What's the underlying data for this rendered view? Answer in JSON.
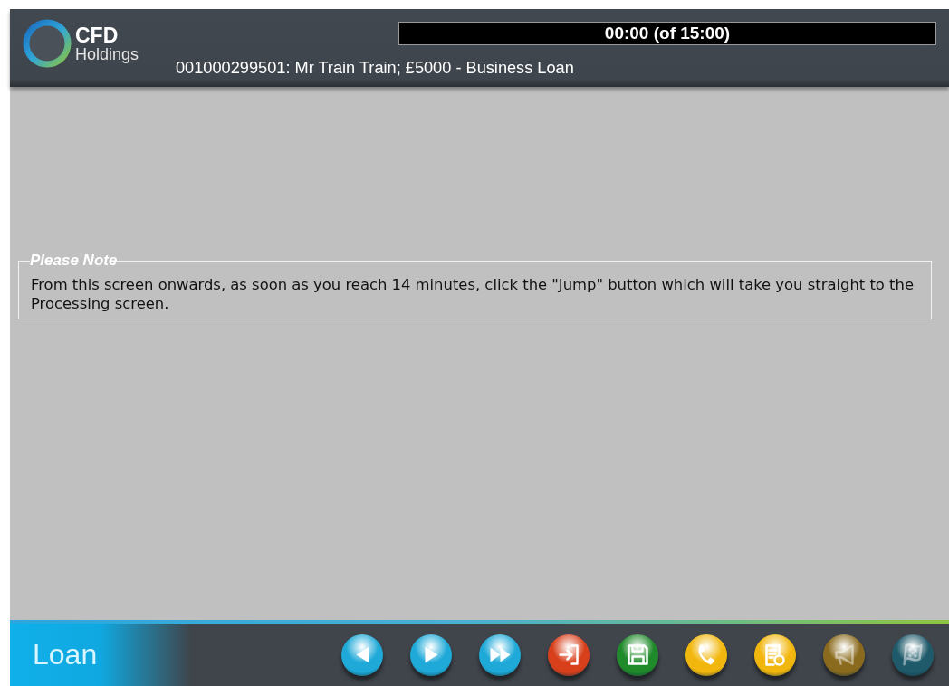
{
  "header": {
    "logo": {
      "name": "CFD",
      "subtitle": "Holdings"
    },
    "timer": "00:00 (of 15:00)",
    "case_line": "001000299501: Mr Train Train; £5000 - Business Loan"
  },
  "note": {
    "title": "Please Note",
    "text": "From this screen onwards, as soon as you reach 14 minutes, click the \"Jump\" button which will take you straight to the Processing screen."
  },
  "footer": {
    "section": "Loan",
    "buttons": [
      {
        "kind": "back",
        "color": "#1fa9d8",
        "disabled": false
      },
      {
        "kind": "forward",
        "color": "#1fa9d8",
        "disabled": false
      },
      {
        "kind": "jump",
        "color": "#1fa9d8",
        "disabled": false
      },
      {
        "kind": "exit",
        "color": "#d8401c",
        "disabled": false
      },
      {
        "kind": "save",
        "color": "#1f8a2a",
        "disabled": false
      },
      {
        "kind": "phone",
        "color": "#f2b70e",
        "disabled": false
      },
      {
        "kind": "note",
        "color": "#f2b70e",
        "disabled": false
      },
      {
        "kind": "megaphone",
        "color": "#8a6a1c",
        "disabled": true
      },
      {
        "kind": "flag",
        "color": "#1e5a6a",
        "disabled": true
      }
    ]
  }
}
